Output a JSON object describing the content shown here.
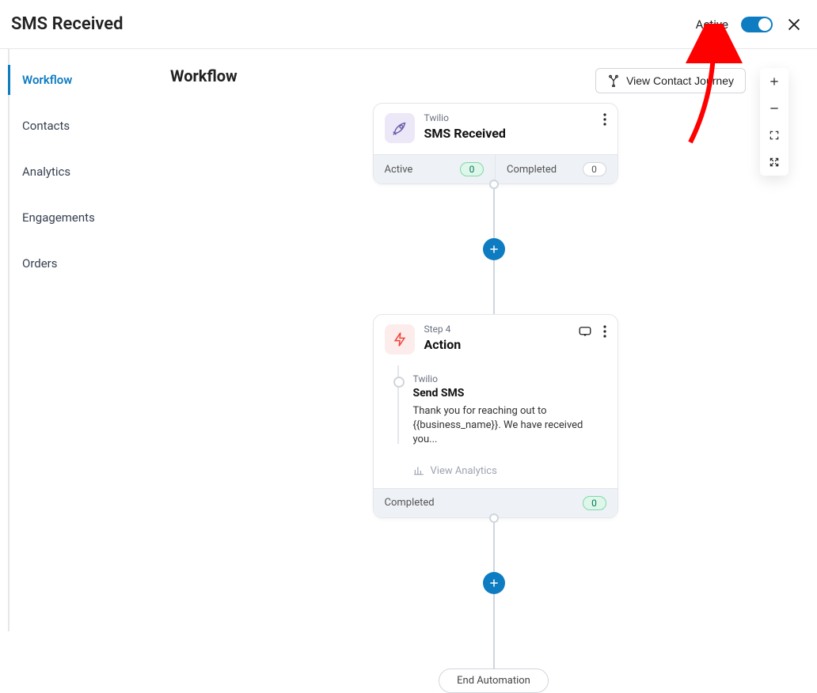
{
  "header": {
    "title": "SMS Received",
    "toggle_label": "Active"
  },
  "sidebar": {
    "items": [
      {
        "label": "Workflow",
        "active": true
      },
      {
        "label": "Contacts",
        "active": false
      },
      {
        "label": "Analytics",
        "active": false
      },
      {
        "label": "Engagements",
        "active": false
      },
      {
        "label": "Orders",
        "active": false
      }
    ]
  },
  "main": {
    "section_title": "Workflow",
    "view_journey_label": "View Contact Journey"
  },
  "flow": {
    "trigger": {
      "source": "Twilio",
      "title": "SMS Received",
      "stats": {
        "active_label": "Active",
        "active_count": "0",
        "completed_label": "Completed",
        "completed_count": "0"
      }
    },
    "action": {
      "step_label": "Step 4",
      "title": "Action",
      "sub_source": "Twilio",
      "sub_title": "Send SMS",
      "sub_text": "Thank you for reaching out to {{business_name}}. We have received you...",
      "view_analytics_label": "View Analytics",
      "footer_label": "Completed",
      "footer_count": "0"
    },
    "end_label": "End Automation"
  }
}
